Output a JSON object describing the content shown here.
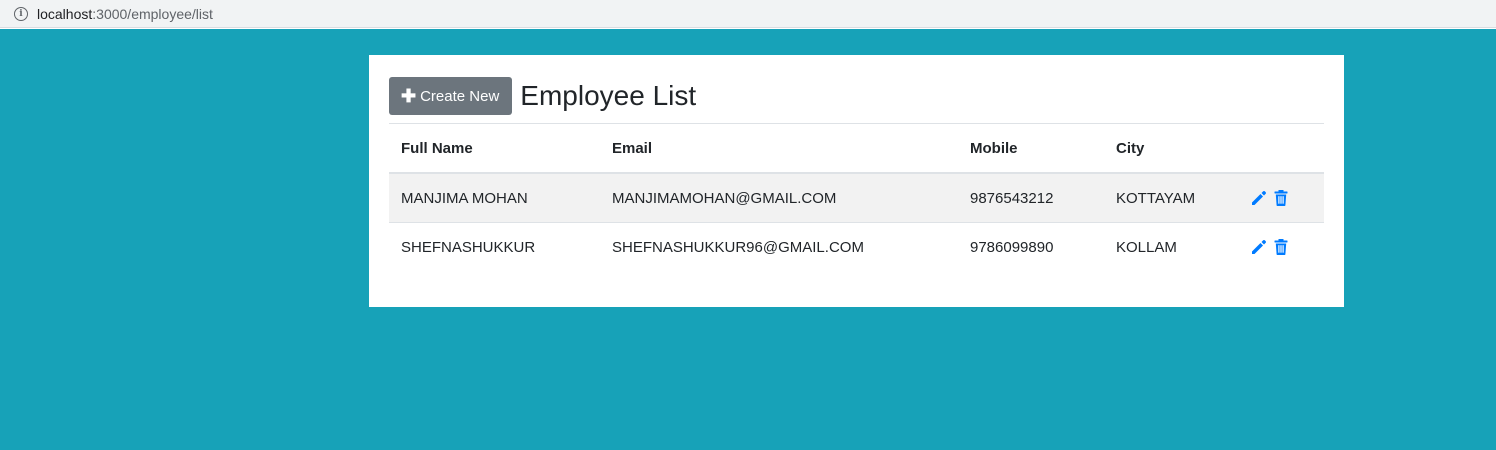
{
  "browser": {
    "url_host": "localhost",
    "url_path": ":3000/employee/list"
  },
  "toolbar": {
    "create_label": "Create New",
    "title": "Employee List"
  },
  "table": {
    "headers": [
      "Full Name",
      "Email",
      "Mobile",
      "City"
    ],
    "rows": [
      [
        "MANJIMA MOHAN",
        "MANJIMAMOHAN@GMAIL.COM",
        "9876543212",
        "KOTTAYAM"
      ],
      [
        "SHEFNASHUKKUR",
        "SHEFNASHUKKUR96@GMAIL.COM",
        "9786099890",
        "KOLLAM"
      ]
    ]
  },
  "colors": {
    "background": "#17a2b8",
    "button": "#6c757d",
    "icon": "#007bff"
  },
  "icons": {
    "edit": "pencil-icon",
    "delete": "trash-icon"
  }
}
